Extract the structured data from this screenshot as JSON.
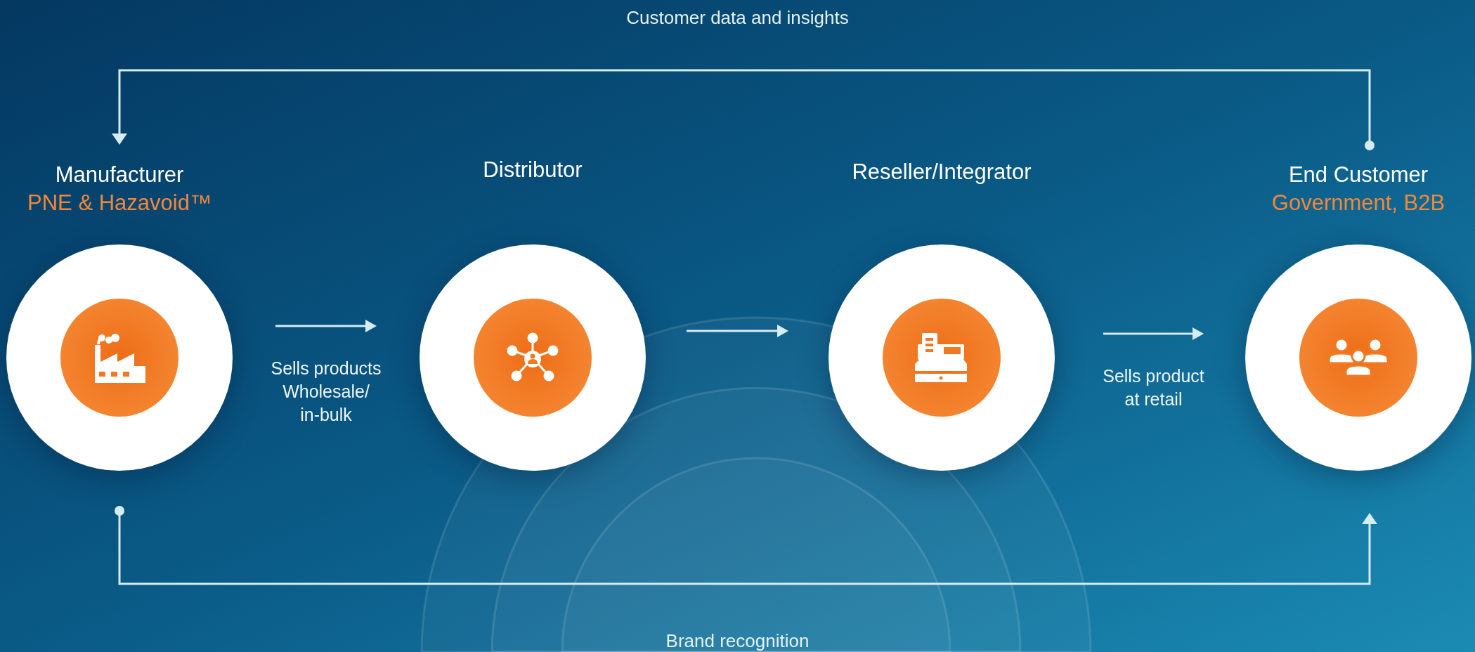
{
  "top_flow": {
    "label": "Customer data and insights"
  },
  "stages": [
    {
      "kind": "factory",
      "title": "Manufacturer",
      "subtitle": "PNE & Hazavoid™"
    },
    {
      "kind": "network",
      "title": "Distributor"
    },
    {
      "kind": "register",
      "title": "Reseller/Integrator"
    },
    {
      "kind": "people",
      "title": "End Customer",
      "subtitle": "Government, B2B"
    }
  ],
  "transitions": [
    {
      "kind": "arrow",
      "lines": [
        "Sells products",
        "Wholesale/",
        "in-bulk"
      ]
    },
    {
      "kind": "arrow"
    },
    {
      "kind": "arrow",
      "lines": [
        "Sells product",
        "at retail"
      ]
    }
  ],
  "bottom_flow": {
    "label": "Brand recognition"
  }
}
